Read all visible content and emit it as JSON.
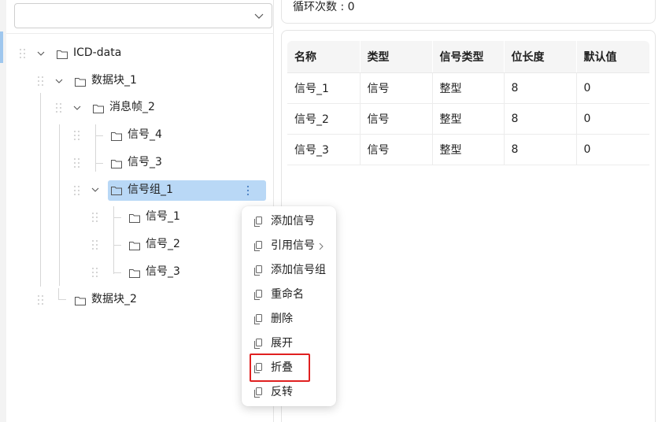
{
  "left_panel": {
    "select": {
      "value": ""
    }
  },
  "tree": {
    "nodes": [
      {
        "label": "ICD-data"
      },
      {
        "label": "数据块_1"
      },
      {
        "label": "消息帧_2"
      },
      {
        "label": "信号_4"
      },
      {
        "label": "信号_3"
      },
      {
        "label": "信号组_1"
      },
      {
        "label": "信号_1"
      },
      {
        "label": "信号_2"
      },
      {
        "label": "信号_3"
      },
      {
        "label": "数据块_2"
      }
    ]
  },
  "header": {
    "loop_count_label": "循环次数 : 0"
  },
  "table": {
    "columns": [
      "名称",
      "类型",
      "信号类型",
      "位长度",
      "默认值"
    ],
    "rows": [
      [
        "信号_1",
        "信号",
        "整型",
        "8",
        "0"
      ],
      [
        "信号_2",
        "信号",
        "整型",
        "8",
        "0"
      ],
      [
        "信号_3",
        "信号",
        "整型",
        "8",
        "0"
      ]
    ]
  },
  "context_menu": {
    "items": [
      {
        "label": "添加信号",
        "icon": "copy-icon"
      },
      {
        "label": "引用信号",
        "icon": "copy-icon",
        "submenu": true
      },
      {
        "label": "添加信号组",
        "icon": "copy-icon"
      },
      {
        "label": "重命名",
        "icon": "copy-icon"
      },
      {
        "label": "删除",
        "icon": "copy-icon"
      },
      {
        "label": "展开",
        "icon": "copy-icon"
      },
      {
        "label": "折叠",
        "icon": "copy-icon",
        "highlighted": true
      },
      {
        "label": "反转",
        "icon": "copy-icon"
      }
    ]
  },
  "colors": {
    "selected_node_bg": "#b9d8f6",
    "highlight_border": "#e02020",
    "left_accent": "#9fc7ee"
  }
}
